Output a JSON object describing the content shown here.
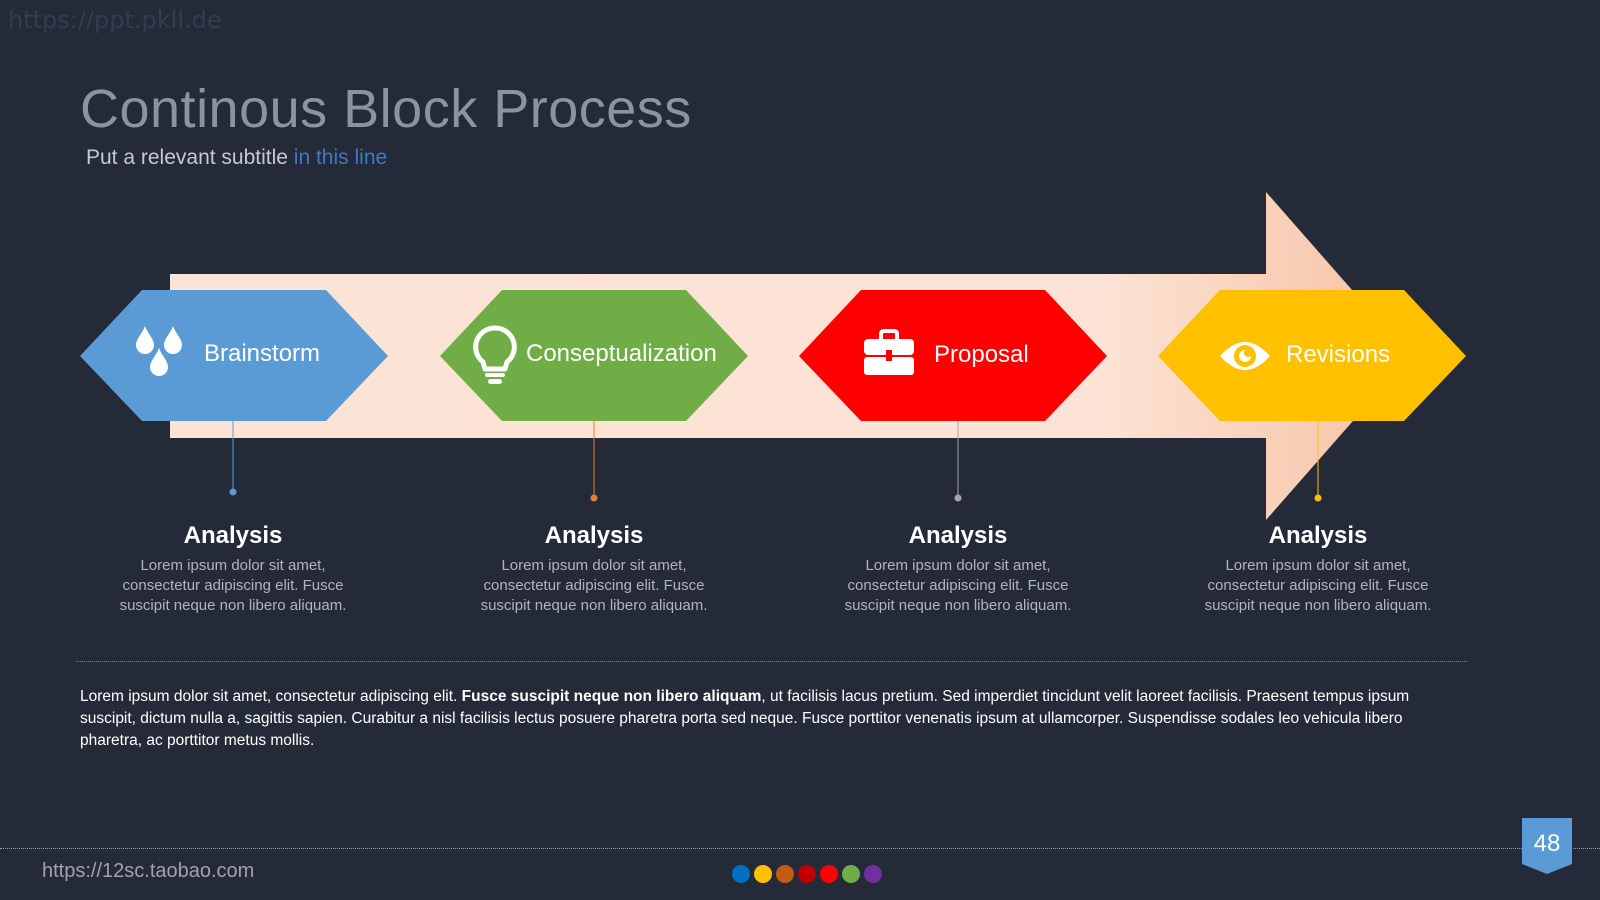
{
  "watermark": "https://ppt.pkll.de",
  "title": "Continous Block Process",
  "subtitle": {
    "main": "Put a relevant subtitle ",
    "accent": "in this line"
  },
  "steps": [
    {
      "label": "Brainstorm",
      "color": "#5b9bd5",
      "icon": "water-drops-icon",
      "dot_color": "#5b9bd5",
      "heading": "Analysis",
      "body": "Lorem ipsum dolor sit amet, consectetur adipiscing elit. Fusce suscipit neque non libero aliquam."
    },
    {
      "label": "Conseptualization",
      "color": "#70ad47",
      "icon": "lightbulb-icon",
      "dot_color": "#ed7d31",
      "heading": "Analysis",
      "body": "Lorem ipsum dolor sit amet, consectetur adipiscing elit. Fusce suscipit neque non libero aliquam."
    },
    {
      "label": "Proposal",
      "color": "#ff0000",
      "icon": "briefcase-icon",
      "dot_color": "#a5a5a5",
      "heading": "Analysis",
      "body": "Lorem ipsum dolor sit amet, consectetur adipiscing elit. Fusce suscipit neque non libero aliquam."
    },
    {
      "label": "Revisions",
      "color": "#ffc000",
      "icon": "eye-icon",
      "dot_color": "#ffc000",
      "heading": "Analysis",
      "body": "Lorem ipsum dolor sit amet, consectetur adipiscing elit. Fusce suscipit neque non libero aliquam."
    }
  ],
  "paragraph": {
    "before": "Lorem ipsum dolor sit amet, consectetur adipiscing elit. ",
    "bold": "Fusce suscipit neque non libero aliquam",
    "after": ", ut facilisis lacus pretium. Sed imperdiet tincidunt velit laoreet facilisis. Praesent tempus ipsum suscipit, dictum nulla a, sagittis sapien. Curabitur a nisl facilisis lectus posuere pharetra porta sed neque. Fusce porttitor venenatis ipsum at ullamcorper. Suspendisse sodales leo vehicula libero pharetra, ac porttitor metus mollis."
  },
  "footer": {
    "url": "https://12sc.taobao.com",
    "page_number": "48",
    "dot_colors": [
      "#0070c0",
      "#ffc000",
      "#c55a11",
      "#c00000",
      "#ff0000",
      "#70ad47",
      "#7030a0"
    ]
  }
}
